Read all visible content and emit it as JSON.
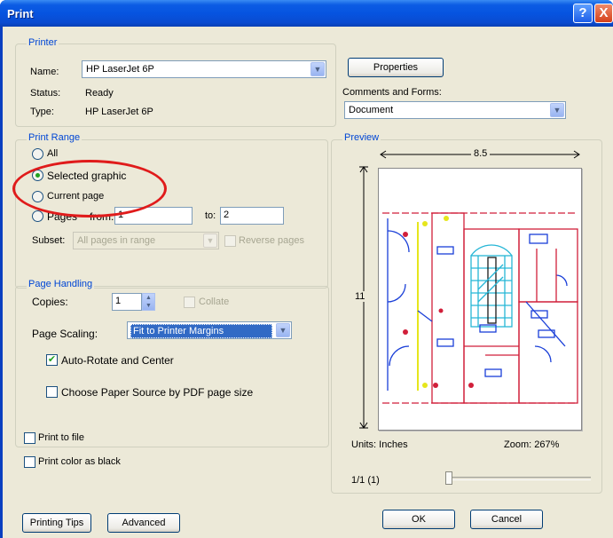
{
  "window": {
    "title": "Print",
    "help_label": "?",
    "close_label": "X"
  },
  "printer": {
    "group_label": "Printer",
    "name_label": "Name:",
    "name_value": "HP LaserJet 6P",
    "status_label": "Status:",
    "status_value": "Ready",
    "type_label": "Type:",
    "type_value": "HP LaserJet 6P",
    "properties_button": "Properties",
    "comments_label": "Comments and Forms:",
    "comments_value": "Document"
  },
  "print_range": {
    "group_label": "Print Range",
    "all_label": "All",
    "selected_label": "Selected graphic",
    "current_label": "Current page",
    "pages_label": "Pages",
    "from_label": "from:",
    "from_value": "1",
    "to_label": "to:",
    "to_value": "2",
    "subset_label": "Subset:",
    "subset_value": "All pages in range",
    "reverse_label": "Reverse pages",
    "selected_option": "Selected graphic"
  },
  "page_handling": {
    "group_label": "Page Handling",
    "copies_label": "Copies:",
    "copies_value": "1",
    "collate_label": "Collate",
    "scaling_label": "Page Scaling:",
    "scaling_value": "Fit to Printer Margins",
    "autorotate_label": "Auto-Rotate and Center",
    "autorotate_checked": true,
    "paper_source_label": "Choose Paper Source by PDF page size",
    "paper_source_checked": false
  },
  "output": {
    "print_to_file_label": "Print to file",
    "print_color_black_label": "Print color as black"
  },
  "preview": {
    "group_label": "Preview",
    "width_label": "8.5",
    "height_label": "11",
    "units_label": "Units: Inches",
    "zoom_label": "Zoom: 267%",
    "page_counter": "1/1 (1)"
  },
  "footer": {
    "tips_button": "Printing Tips",
    "advanced_button": "Advanced",
    "ok_button": "OK",
    "cancel_button": "Cancel"
  },
  "colors": {
    "title_blue": "#0654e0",
    "dialog_bg": "#ece9d8",
    "group_label_blue": "#0046d5",
    "annotation_red": "#e01b1b",
    "drawing_red": "#d11f3a",
    "drawing_blue": "#1a3fd8",
    "drawing_cyan": "#26b6d6"
  }
}
